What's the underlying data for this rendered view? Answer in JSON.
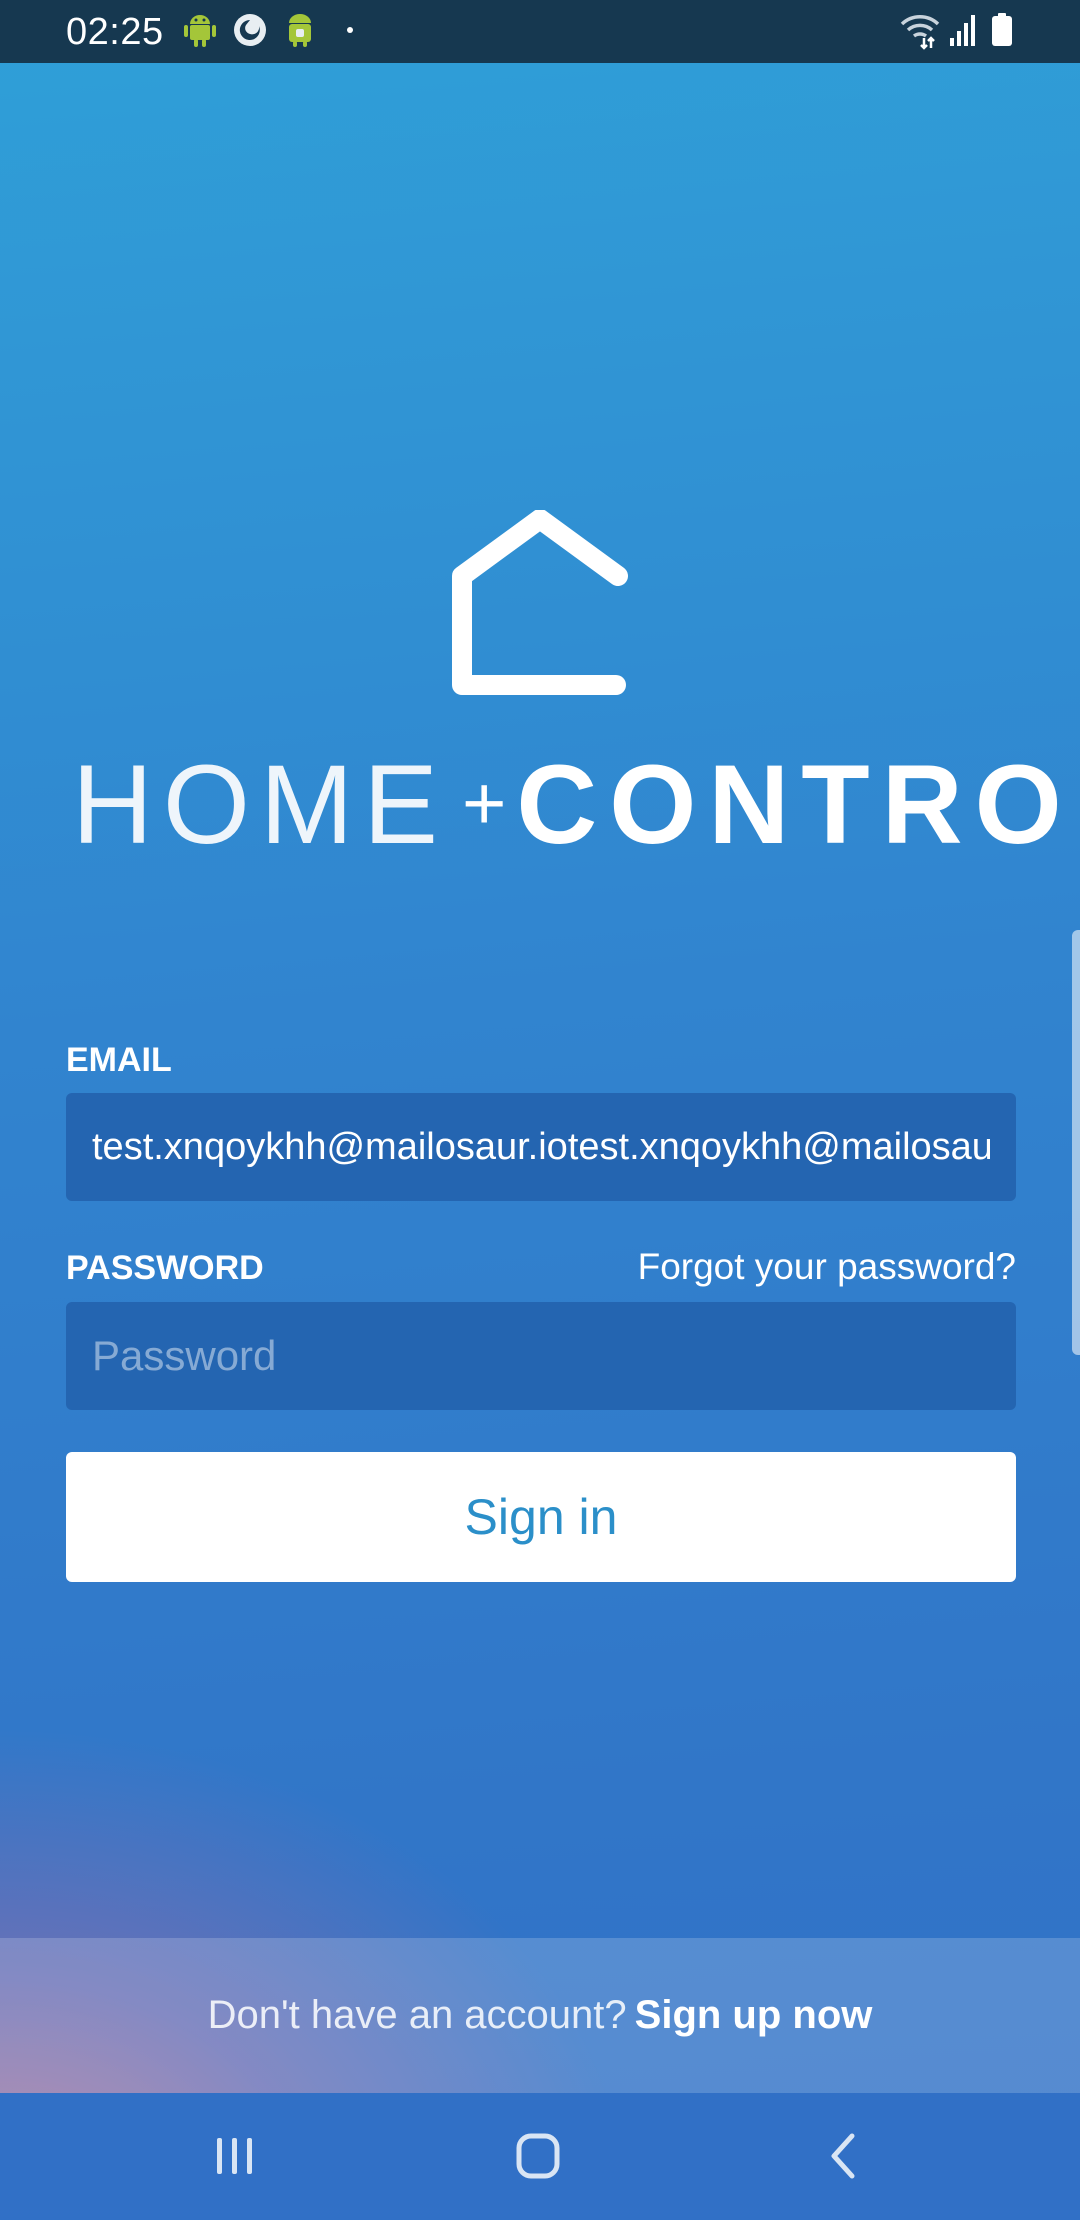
{
  "status_bar": {
    "time": "02:25",
    "icons": [
      "android-icon",
      "firefox-icon",
      "android-notification-icon",
      "dot-icon",
      "wifi-icon",
      "signal-icon",
      "battery-icon"
    ]
  },
  "logo": {
    "icon": "house-icon",
    "word_home": "HOME",
    "plus": "+",
    "word_control": "CONTROL"
  },
  "form": {
    "email_label": "EMAIL",
    "email_value": "test.xnqoykhh@mailosaur.iotest.xnqoykhh@mailosaur.io",
    "password_label": "PASSWORD",
    "forgot_password": "Forgot your password?",
    "password_placeholder": "Password",
    "password_value": "",
    "sign_in": "Sign in"
  },
  "signup": {
    "prompt": "Don't have an account?",
    "link": "Sign up now"
  },
  "navbar": {
    "buttons": [
      "recent-apps-icon",
      "home-icon",
      "back-icon"
    ]
  },
  "colors": {
    "status_bar_bg": "#163850",
    "gradient_top": "#2fa0d8",
    "gradient_bottom": "#3170c6",
    "field_bg": "#2465b1",
    "button_text": "#2b8fc9",
    "navbar_bg": "#3170c6"
  }
}
